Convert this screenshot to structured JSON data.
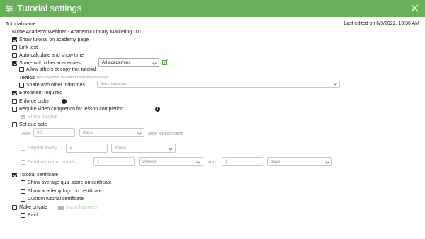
{
  "window": {
    "title": "Tutorial settings"
  },
  "tutorial_name": {
    "label": "Tutorial name",
    "value": "Niche Academy Webinar - Academic Library Marketing 101"
  },
  "last_edited": "Last edited on 6/9/2022, 10:36 AM",
  "options": {
    "show_on_academy_page": "Show tutorial on academy page",
    "link_text": "Link text",
    "auto_calculate": "Auto calculate and show time",
    "share_with_academies": "Share with other academies",
    "academies_select": "All academies",
    "allow_copy": "Allow others ot copy this tutorial",
    "topics_label": "Tonics",
    "topics_hint": "Type keywords hit Enter to add/request a topic",
    "share_with_industries": "Share with other industries",
    "industries_placeholder": "Select industries",
    "enrollment_required": "Enrollment required",
    "enforce_order": "Enforce order",
    "require_video": "Require video completion for lesson completion",
    "show_playbar": "Show playbar",
    "set_due_date": "Set due date",
    "due_label": "Due:",
    "due_value": "90",
    "due_unit": "days",
    "after_enrollment": "after enrollment",
    "repeat_every": "Repeat every",
    "repeat_value": "1",
    "repeat_unit": "Years",
    "send_reminder": "Send reminder emails",
    "reminder_value": "1",
    "reminder_unit": "Weeks",
    "and_label": "and",
    "reminder_value2": "1",
    "reminder_unit2": "days",
    "tutorial_certificate": "Tutorial certificate",
    "show_avg_score": "Show average quiz score on certficate",
    "show_logo": "Show academy logo on certificate",
    "custom_certificate": "Custom tutorial certificate",
    "make_private": "Make private",
    "invite_learners": "Invite learners",
    "paid": "Paid"
  },
  "info_glyph": "i"
}
